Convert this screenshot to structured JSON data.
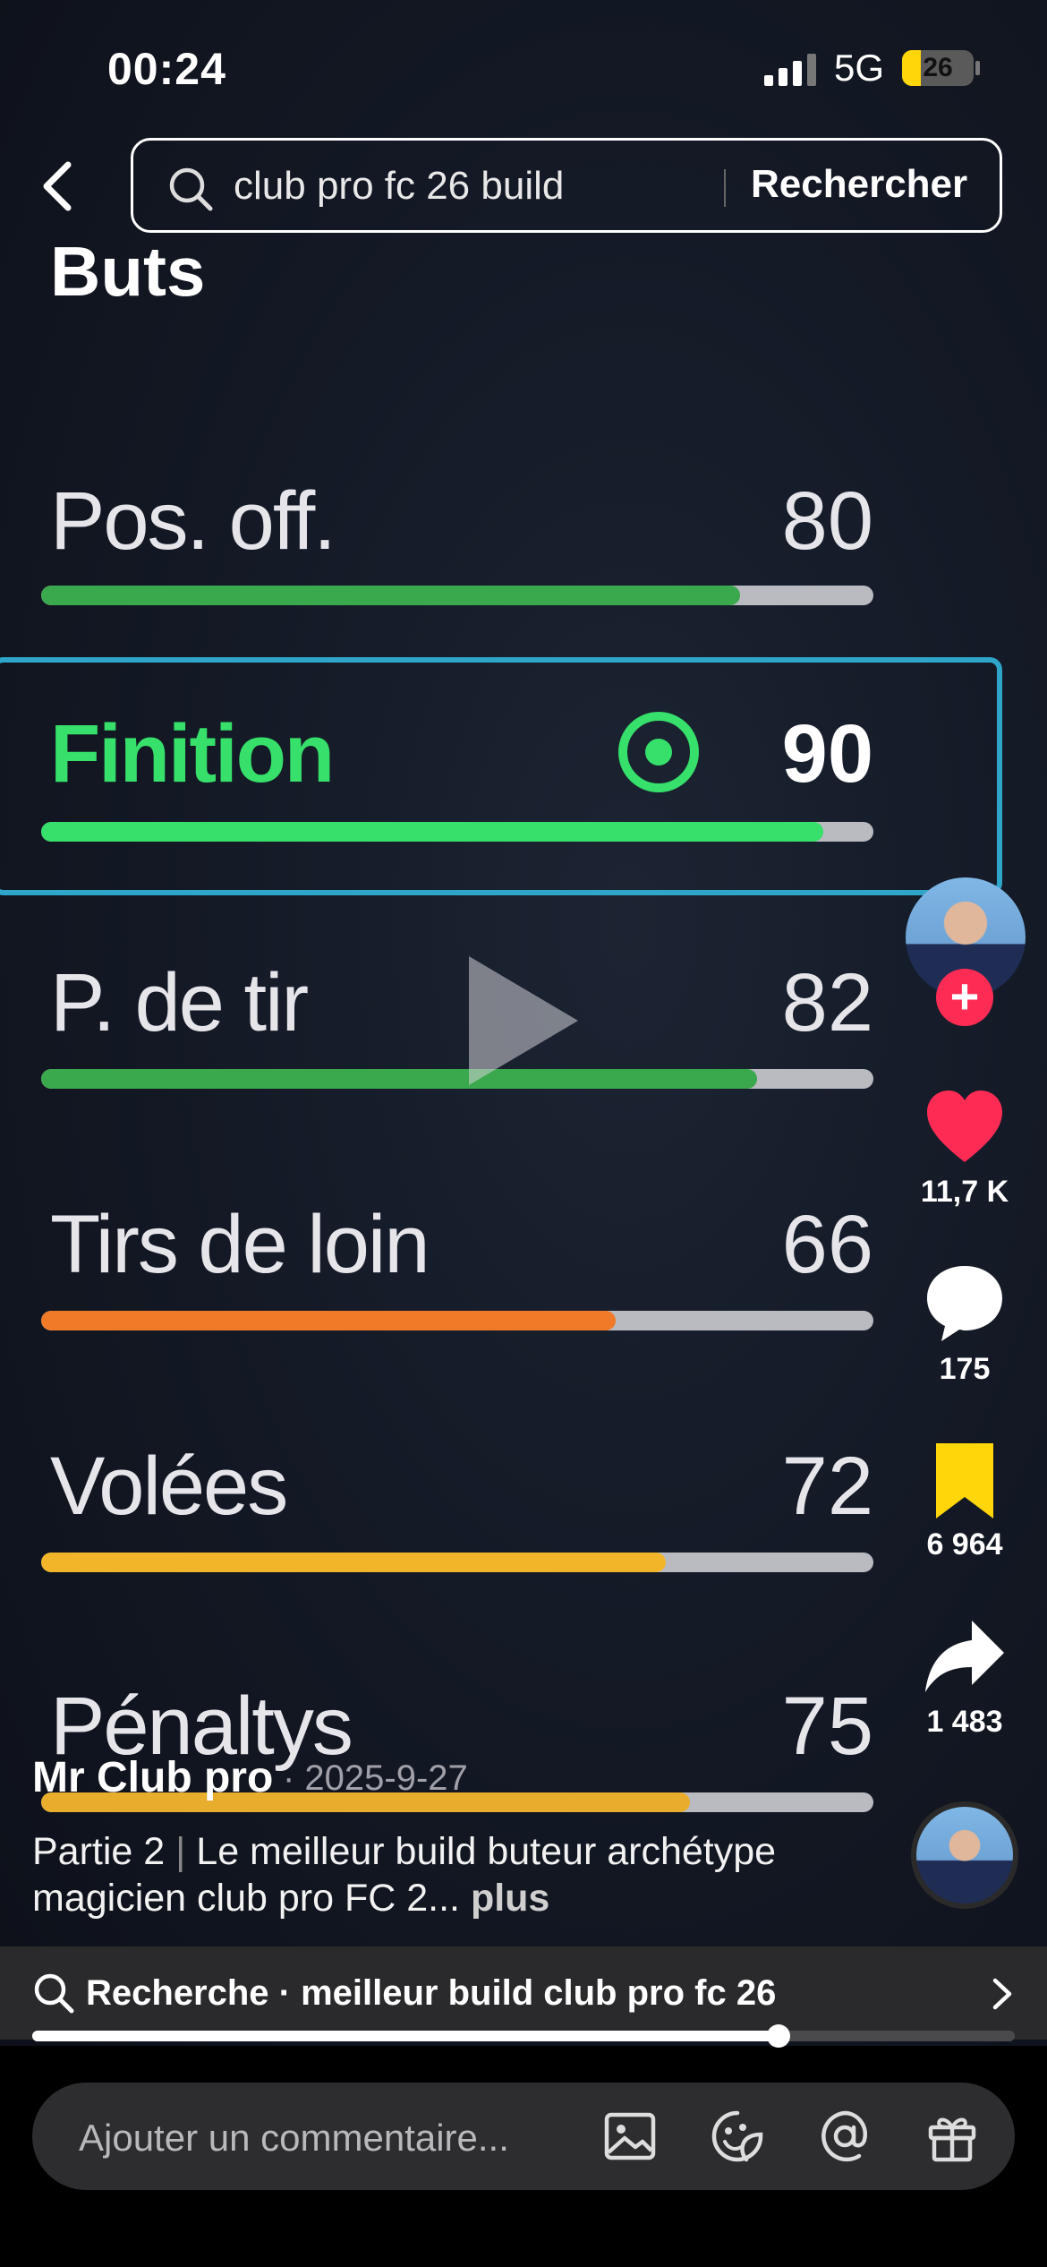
{
  "status_bar": {
    "time": "00:24",
    "network": "5G",
    "battery": "26",
    "battery_level": 0.26
  },
  "search": {
    "query": "club pro fc 26 build",
    "button_label": "Rechercher"
  },
  "video": {
    "section_title": "Buts",
    "stats": [
      {
        "label": "Pos. off.",
        "value": "80",
        "fill": 0.84,
        "color": "#3aa84c"
      },
      {
        "label": "Finition",
        "value": "90",
        "fill": 0.94,
        "color": "#36e06a",
        "highlighted": true
      },
      {
        "label": "P. de tir",
        "value": "82",
        "fill": 0.86,
        "color": "#3aa84c"
      },
      {
        "label": "Tirs de loin",
        "value": "66",
        "fill": 0.69,
        "color": "#f07a28"
      },
      {
        "label": "Volées",
        "value": "72",
        "fill": 0.75,
        "color": "#f2b52a"
      },
      {
        "label": "Pénaltys",
        "value": "75",
        "fill": 0.78,
        "color": "#e8ad2c"
      }
    ]
  },
  "rail": {
    "likes": "11,7 K",
    "comments": "175",
    "saves": "6 964",
    "shares": "1 483"
  },
  "post": {
    "author": "Mr Club pro",
    "date": "· 2025-9-27",
    "caption_part": "Partie 2",
    "caption_sep": "|",
    "caption_text": "Le meilleur build buteur archétype magicien club pro FC 2...",
    "more": "plus"
  },
  "suggestion": {
    "text": "Recherche · meilleur build club pro fc 26"
  },
  "playback": {
    "progress": 0.76
  },
  "comment_bar": {
    "placeholder": "Ajouter un commentaire..."
  },
  "colors": {
    "accent_red": "#fe2c55",
    "save_yellow": "#ffd60a",
    "highlight_border": "#2fa5c9"
  }
}
